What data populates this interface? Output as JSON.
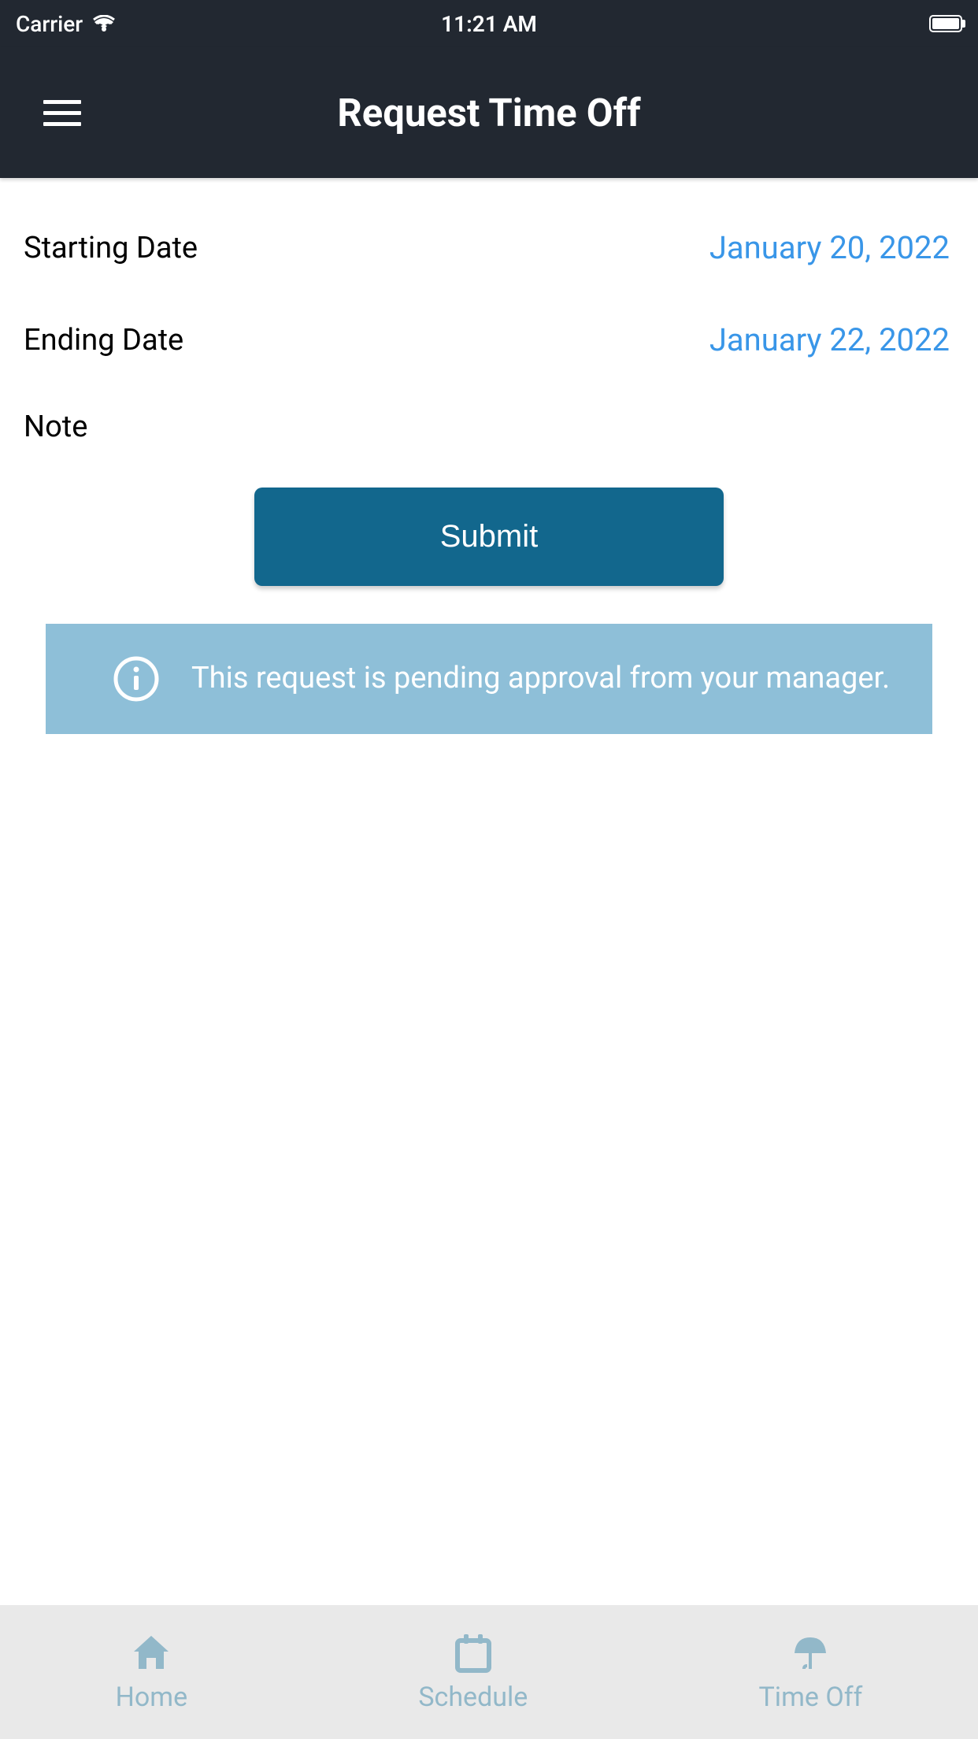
{
  "status_bar": {
    "carrier": "Carrier",
    "time": "11:21 AM"
  },
  "header": {
    "title": "Request Time Off"
  },
  "form": {
    "starting_date": {
      "label": "Starting Date",
      "value": "January 20, 2022"
    },
    "ending_date": {
      "label": "Ending Date",
      "value": "January 22, 2022"
    },
    "note": {
      "label": "Note"
    },
    "submit_label": "Submit"
  },
  "info_banner": {
    "message": "This request is pending approval from your manager."
  },
  "bottom_nav": {
    "items": [
      {
        "label": "Home",
        "icon": "home-icon"
      },
      {
        "label": "Schedule",
        "icon": "calendar-icon"
      },
      {
        "label": "Time Off",
        "icon": "umbrella-icon"
      }
    ]
  }
}
